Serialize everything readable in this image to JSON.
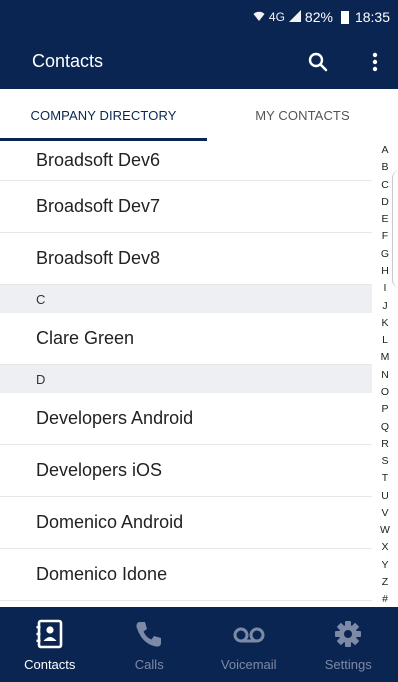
{
  "status_bar": {
    "signal": "4G",
    "battery": "82%",
    "time": "18:35"
  },
  "app_bar": {
    "title": "Contacts"
  },
  "tabs": [
    {
      "label": "COMPANY DIRECTORY",
      "active": true
    },
    {
      "label": "MY CONTACTS",
      "active": false
    }
  ],
  "contacts": {
    "items": [
      {
        "type": "contact",
        "name": "Broadsoft Dev6"
      },
      {
        "type": "contact",
        "name": "Broadsoft Dev7"
      },
      {
        "type": "contact",
        "name": "Broadsoft Dev8"
      },
      {
        "type": "header",
        "name": "C"
      },
      {
        "type": "contact",
        "name": "Clare  Green"
      },
      {
        "type": "header",
        "name": "D"
      },
      {
        "type": "contact",
        "name": "Developers Android"
      },
      {
        "type": "contact",
        "name": "Developers iOS"
      },
      {
        "type": "contact",
        "name": "Domenico Android"
      },
      {
        "type": "contact",
        "name": "Domenico Idone"
      }
    ]
  },
  "alphabet": [
    "A",
    "B",
    "C",
    "D",
    "E",
    "F",
    "G",
    "H",
    "I",
    "J",
    "K",
    "L",
    "M",
    "N",
    "O",
    "P",
    "Q",
    "R",
    "S",
    "T",
    "U",
    "V",
    "W",
    "X",
    "Y",
    "Z",
    "#"
  ],
  "bottom_nav": [
    {
      "label": "Contacts",
      "icon": "contacts-book-icon",
      "active": true
    },
    {
      "label": "Calls",
      "icon": "phone-icon",
      "active": false
    },
    {
      "label": "Voicemail",
      "icon": "voicemail-icon",
      "active": false
    },
    {
      "label": "Settings",
      "icon": "gear-icon",
      "active": false
    }
  ],
  "colors": {
    "primary": "#0a2551",
    "section_bg": "#eeeff2",
    "inactive_nav": "#7d8aa6"
  }
}
